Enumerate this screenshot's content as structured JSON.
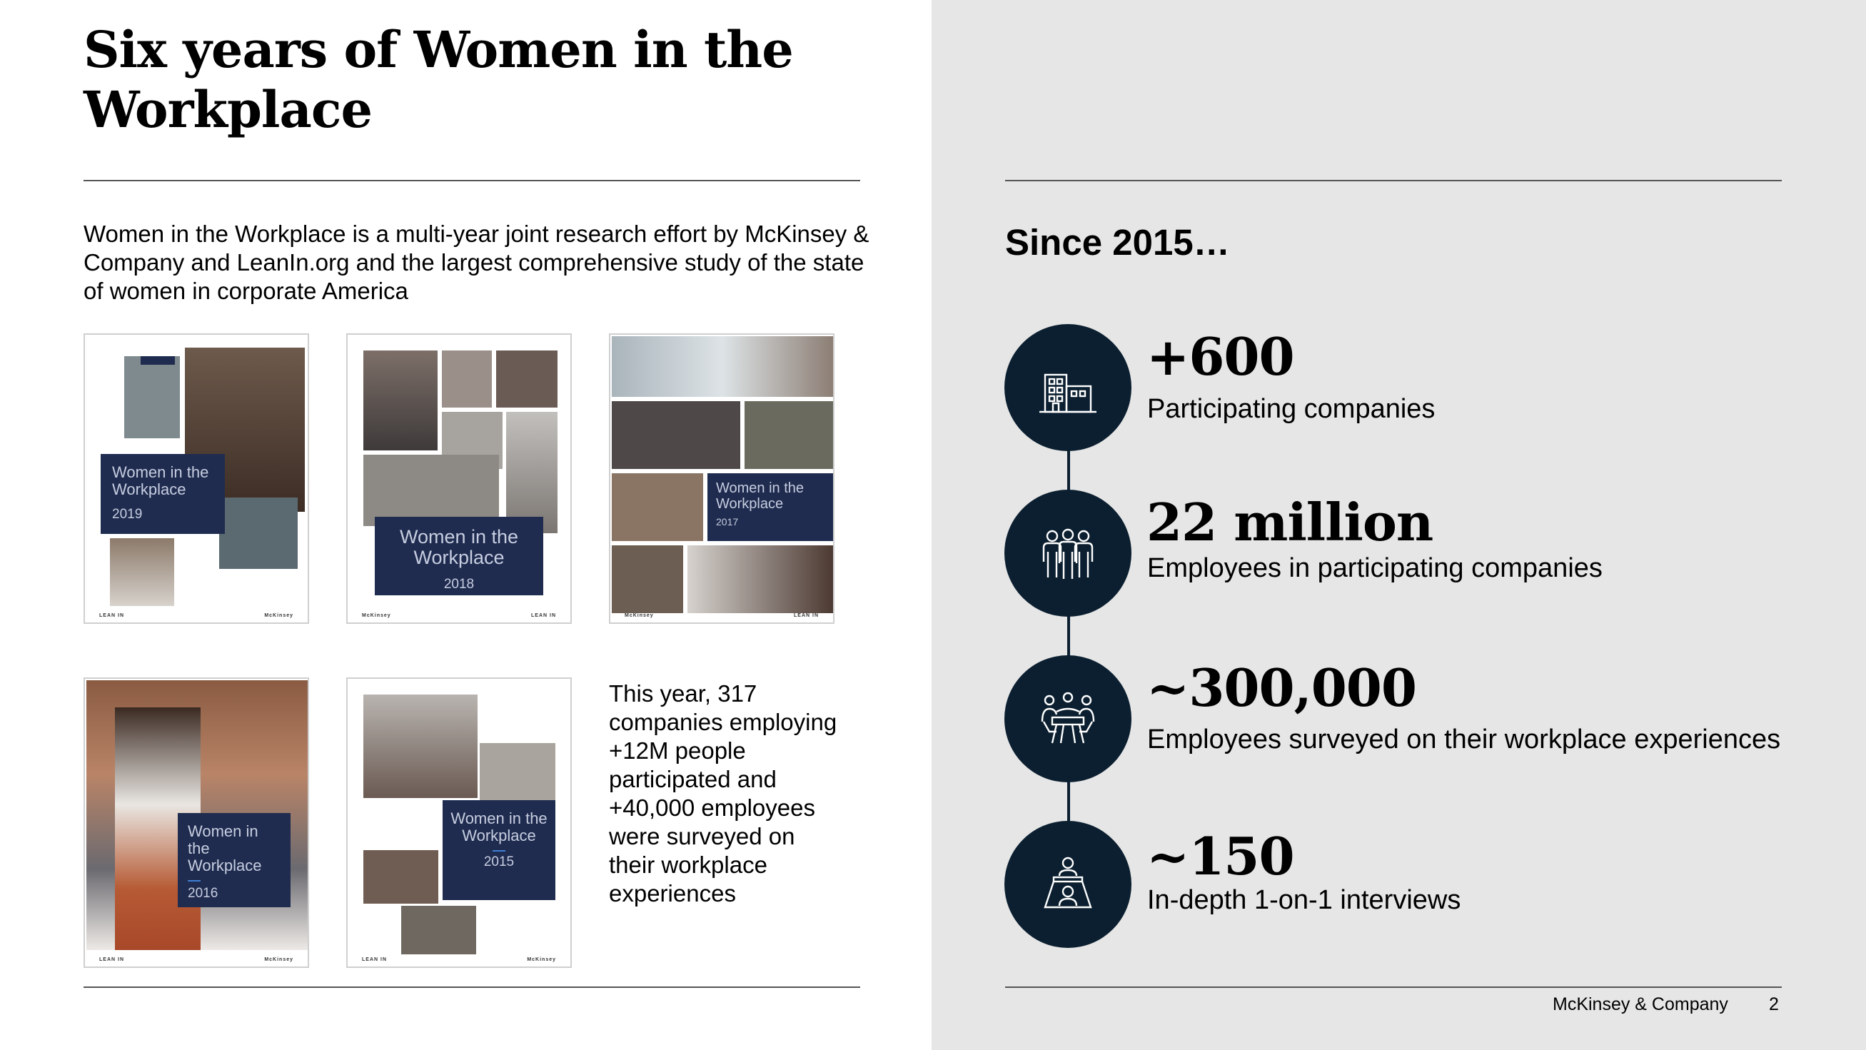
{
  "page": {
    "title": "Six years of Women in the Workplace",
    "intro": "Women in the Workplace is a multi-year joint research effort by McKinsey & Company and LeanIn.org and the largest comprehensive study of the state of women in corporate America",
    "year_summary": "This year, 317 companies employing +12M people participated and +40,000 employees were surveyed on their workplace experiences"
  },
  "covers": [
    {
      "title": "Women in the Workplace",
      "year": "2019"
    },
    {
      "title": "Women in the Workplace",
      "year": "2018"
    },
    {
      "title": "Women in the Workplace",
      "year": "2017"
    },
    {
      "title": "Women in the Workplace",
      "year": "2016"
    },
    {
      "title": "Women in the Workplace",
      "year": "2015"
    }
  ],
  "since": {
    "heading": "Since 2015…",
    "stats": [
      {
        "value": "+600",
        "label": "Participating companies",
        "icon": "buildings-icon"
      },
      {
        "value": "22 million",
        "label": "Employees in participating companies",
        "icon": "people-group-icon"
      },
      {
        "value": "~300,000",
        "label": "Employees surveyed on their workplace experiences",
        "icon": "meeting-table-icon"
      },
      {
        "value": "~150",
        "label": "In-depth 1-on-1 interviews",
        "icon": "interview-icon"
      }
    ]
  },
  "footer": {
    "brand": "McKinsey & Company",
    "page_number": "2"
  },
  "colors": {
    "accent": "#0b1f30",
    "cover_box": "#1f2c4f",
    "panel_bg": "#e6e6e6"
  }
}
